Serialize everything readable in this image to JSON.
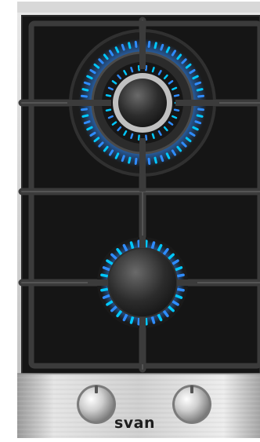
{
  "appliance": {
    "brand": "svan",
    "burner_count": 2,
    "knob_count": 2,
    "icons": [
      "wok-burner-icon",
      "small-burner-icon",
      "control-knob-icon"
    ]
  },
  "colors": {
    "glass": "#141414",
    "grate": "#3a3a3a",
    "flame": "#2f8cff",
    "flame_core": "#00c8ff",
    "steel": "#c9c9c9",
    "background": "#ffffff"
  }
}
